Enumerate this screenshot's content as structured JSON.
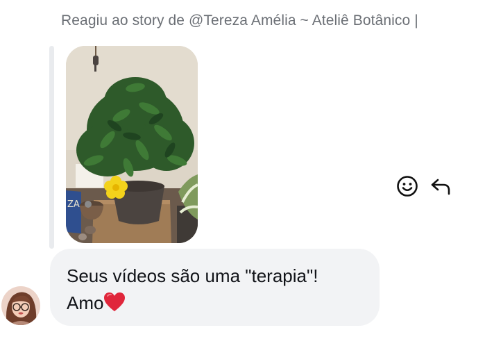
{
  "header": {
    "story_reply_text": "Reagiu ao story de @Tereza Amélia ~ Ateliê Botânico |"
  },
  "story": {
    "image_alt": "Vaso de planta com flor amarela"
  },
  "actions": {
    "react_icon": "smiley-icon",
    "reply_icon": "reply-arrow-icon"
  },
  "message": {
    "line1": "Seus vídeos são uma \"terapia\"!",
    "line2_text": "Amo",
    "line2_emoji": "heart-emoji"
  },
  "colors": {
    "bubble_bg": "#f2f3f5",
    "header_text": "#6b6f75",
    "heart": "#e0263b"
  }
}
